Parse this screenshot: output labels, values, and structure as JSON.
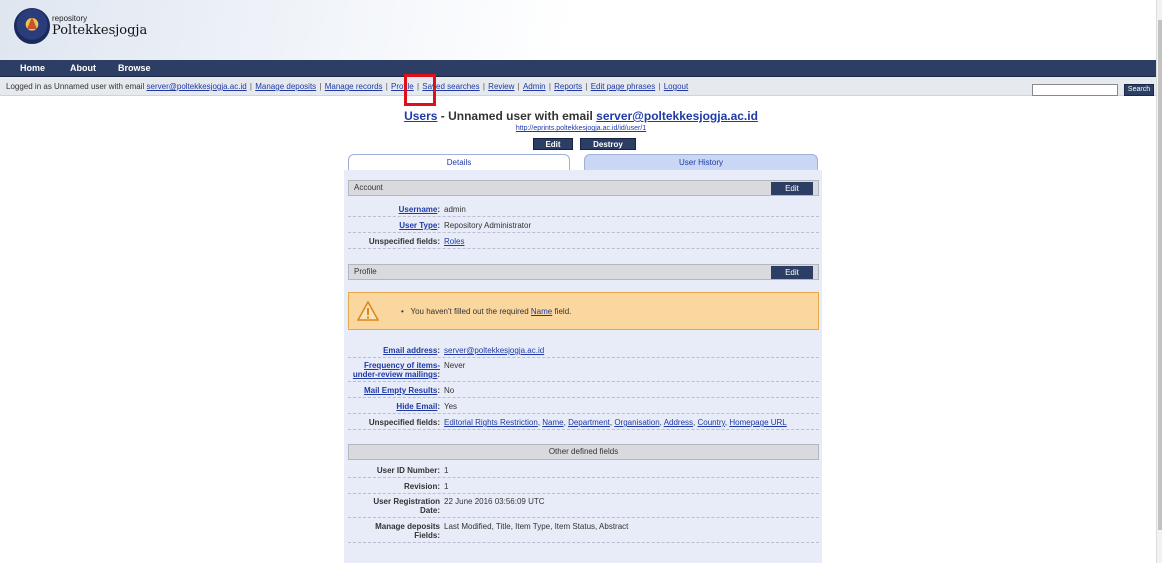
{
  "logo": {
    "small": "repository",
    "big": "Poltekkesjogja"
  },
  "nav": {
    "home": "Home",
    "about": "About",
    "browse": "Browse"
  },
  "toolbar": {
    "logged_in_prefix": "Logged in as Unnamed user with email ",
    "user_email": "server@poltekkesjogja.ac.id",
    "links": [
      "Manage deposits",
      "Manage records",
      "Profile",
      "Saved searches",
      "Review",
      "Admin",
      "Reports",
      "Edit page phrases",
      "Logout"
    ],
    "search_value": "",
    "search_button": "Search"
  },
  "title": {
    "users_link": "Users",
    "middle": " - Unnamed user with email ",
    "email": "server@poltekkesjogja.ac.id",
    "url": "http://eprints.poltekkesjogja.ac.id/id/user/1"
  },
  "buttons": {
    "edit": "Edit",
    "destroy": "Destroy"
  },
  "tabs": {
    "details": "Details",
    "history": "User History"
  },
  "account": {
    "header": "Account",
    "edit": "Edit",
    "username_label": "Username",
    "username": "admin",
    "usertype_label": "User Type",
    "usertype": "Repository Administrator",
    "unspecified_label": "Unspecified fields:",
    "unspecified": "Roles"
  },
  "profile": {
    "header": "Profile",
    "edit": "Edit",
    "warning_pre": "You haven't filled out the required ",
    "warning_link": "Name",
    "warning_post": " field.",
    "email_label": "Email address",
    "email": "server@poltekkesjogja.ac.id",
    "freq_label_1": "Frequency of items-",
    "freq_label_2": "under-review mailings",
    "freq": "Never",
    "mail_label": "Mail Empty Results",
    "mail": "No",
    "hide_label": "Hide Email",
    "hide": "Yes",
    "unspecified_label": "Unspecified fields:",
    "unspecified": [
      "Editorial Rights Restriction",
      "Name",
      "Department",
      "Organisation",
      "Address",
      "Country",
      "Homepage URL"
    ]
  },
  "other": {
    "header": "Other defined fields",
    "userid_label": "User ID Number:",
    "userid": "1",
    "revision_label": "Revision:",
    "revision": "1",
    "reg_label_1": "User Registration",
    "reg_label_2": "Date:",
    "reg": "22 June 2016 03:56:09 UTC",
    "md_label_1": "Manage deposits",
    "md_label_2": "Fields:",
    "md": "Last Modified, Title, Item Type, Item Status, Abstract"
  }
}
